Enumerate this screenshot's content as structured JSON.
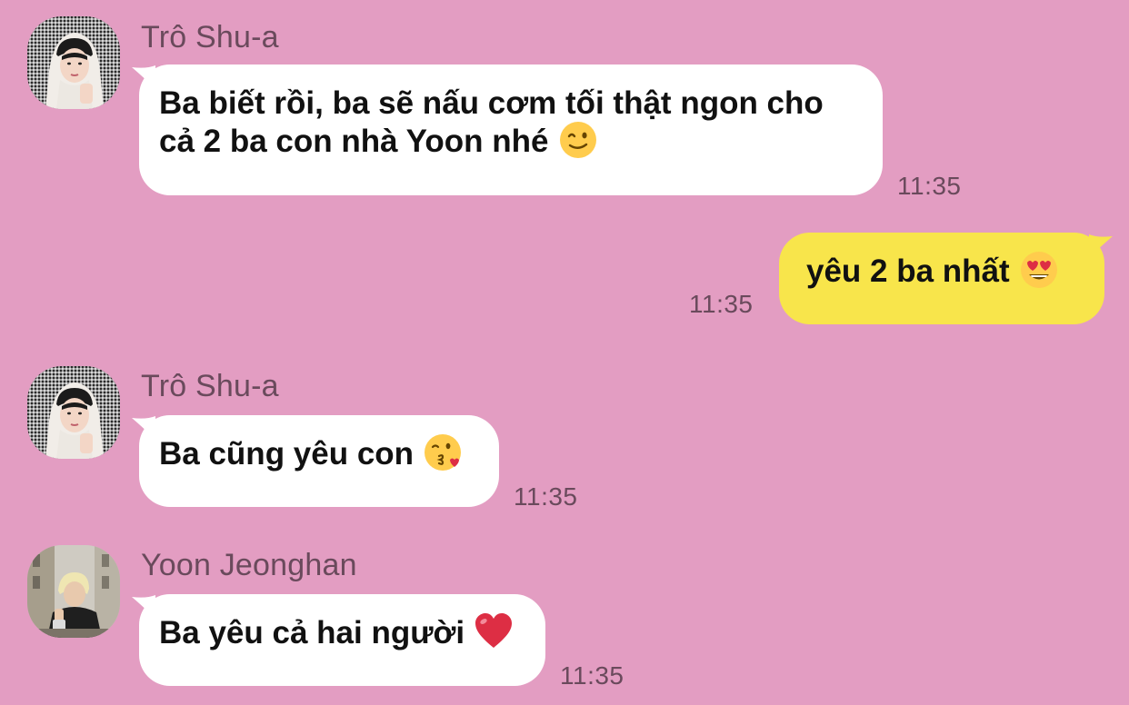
{
  "messages": [
    {
      "sender": "Trô Shu-a",
      "direction": "incoming",
      "text": "Ba biết rồi, ba sẽ nấu cơm tối thật ngon cho cả 2 ba con nhà Yoon nhé",
      "line1": "Ba biết rồi, ba sẽ nấu cơm tối thật ngon cho",
      "line2": "cả 2 ba con nhà Yoon nhé",
      "emoji": "winking-face-emoji",
      "time": "11:35"
    },
    {
      "direction": "outgoing",
      "text": "yêu 2 ba nhất",
      "emoji": "heart-eyes-emoji",
      "time": "11:35"
    },
    {
      "sender": "Trô Shu-a",
      "direction": "incoming",
      "text": "Ba cũng yêu con",
      "emoji": "kissing-face-emoji",
      "time": "11:35"
    },
    {
      "sender": "Yoon Jeonghan",
      "direction": "incoming",
      "text": "Ba yêu cả hai người",
      "emoji": "red-heart-emoji",
      "time": "11:35"
    }
  ],
  "colors": {
    "background": "#e39dc2",
    "incoming_bubble": "#ffffff",
    "outgoing_bubble": "#f8e54b",
    "meta_text": "#6a4a5c"
  }
}
